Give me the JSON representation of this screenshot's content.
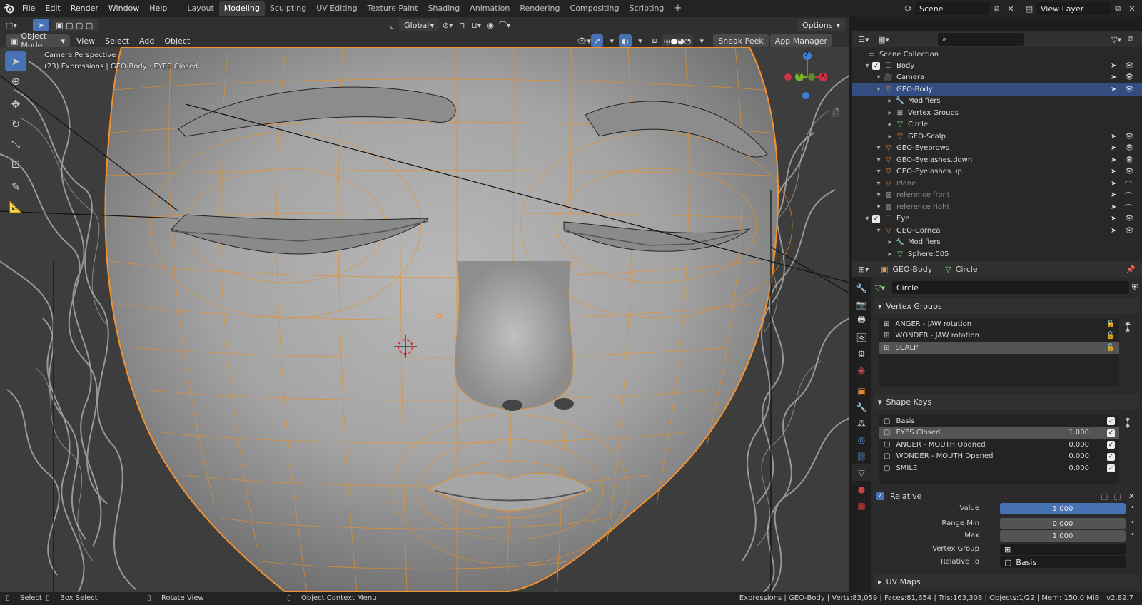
{
  "menu": {
    "items": [
      "File",
      "Edit",
      "Render",
      "Window",
      "Help"
    ],
    "workspaces": [
      "Layout",
      "Modeling",
      "Sculpting",
      "UV Editing",
      "Texture Paint",
      "Shading",
      "Animation",
      "Rendering",
      "Compositing",
      "Scripting"
    ],
    "active_workspace": "Modeling",
    "add_tab": "+",
    "scene": "Scene",
    "view_layer": "View Layer"
  },
  "viewport": {
    "mode": "Object Mode",
    "menus": [
      "View",
      "Select",
      "Add",
      "Object"
    ],
    "orientation": "Global",
    "options": "Options",
    "sneak_peek": "Sneak Peek",
    "app_manager": "App Manager",
    "overlay_line1": "Camera Perspective",
    "overlay_line2": "(23) Expressions | GEO-Body : EYES Closed",
    "gizmo": {
      "z": "Z",
      "y": "Y",
      "x": "X"
    }
  },
  "outliner": {
    "root": "Scene Collection",
    "rows": [
      {
        "label": "Body",
        "level": 1,
        "type": "collection",
        "checked": true
      },
      {
        "label": "Camera",
        "level": 2,
        "type": "camera"
      },
      {
        "label": "GEO-Body",
        "level": 2,
        "type": "mesh",
        "selected": true
      },
      {
        "label": "Modifiers",
        "level": 3,
        "type": "wrench"
      },
      {
        "label": "Vertex Groups",
        "level": 3,
        "type": "vgroup"
      },
      {
        "label": "Circle",
        "level": 3,
        "type": "meshdata"
      },
      {
        "label": "GEO-Scalp",
        "level": 3,
        "type": "mesh"
      },
      {
        "label": "GEO-Eyebrows",
        "level": 2,
        "type": "mesh"
      },
      {
        "label": "GEO-Eyelashes.down",
        "level": 2,
        "type": "mesh"
      },
      {
        "label": "GEO-Eyelashes.up",
        "level": 2,
        "type": "mesh"
      },
      {
        "label": "Plane",
        "level": 2,
        "type": "mesh",
        "dim": true
      },
      {
        "label": "reference front",
        "level": 2,
        "type": "image",
        "dim": true
      },
      {
        "label": "reference right",
        "level": 2,
        "type": "image",
        "dim": true
      },
      {
        "label": "Eye",
        "level": 1,
        "type": "collection",
        "checked": true
      },
      {
        "label": "GEO-Cornea",
        "level": 2,
        "type": "mesh"
      },
      {
        "label": "Modifiers",
        "level": 3,
        "type": "wrench"
      },
      {
        "label": "Sphere.005",
        "level": 3,
        "type": "meshdata"
      },
      {
        "label": "GEO-Eyeball",
        "level": 3,
        "type": "mesh"
      }
    ]
  },
  "properties": {
    "object": "GEO-Body",
    "data": "Circle",
    "mesh_name": "Circle",
    "vertex_groups": {
      "title": "Vertex Groups",
      "items": [
        "ANGER - JAW rotation",
        "WONDER - JAW rotation",
        "SCALP"
      ],
      "selected": 2
    },
    "shape_keys": {
      "title": "Shape Keys",
      "items": [
        {
          "name": "Basis",
          "value": ""
        },
        {
          "name": "EYES Closed",
          "value": "1.000",
          "selected": true
        },
        {
          "name": "ANGER - MOUTH Opened",
          "value": "0.000"
        },
        {
          "name": "WONDER - MOUTH Opened",
          "value": "0.000"
        },
        {
          "name": "SMILE",
          "value": "0.000"
        }
      ]
    },
    "relative_label": "Relative",
    "value_label": "Value",
    "value": "1.000",
    "value_fraction": 1.0,
    "range_min_label": "Range Min",
    "range_min": "0.000",
    "max_label": "Max",
    "max": "1.000",
    "vertex_group_label": "Vertex Group",
    "relative_to_label": "Relative To",
    "relative_to": "Basis",
    "uv_maps": "UV Maps"
  },
  "status": {
    "select": "Select",
    "box_select": "Box Select",
    "rotate_view": "Rotate View",
    "context_menu": "Object Context Menu",
    "stats": "Expressions | GEO-Body | Verts:83,059 | Faces:81,654 | Tris:163,308 | Objects:1/22 | Mem: 150.0 MiB | v2.82.7"
  },
  "colors": {
    "accent": "#4772b3",
    "selection_outline": "#f5922f",
    "wire": "#e4902c"
  }
}
